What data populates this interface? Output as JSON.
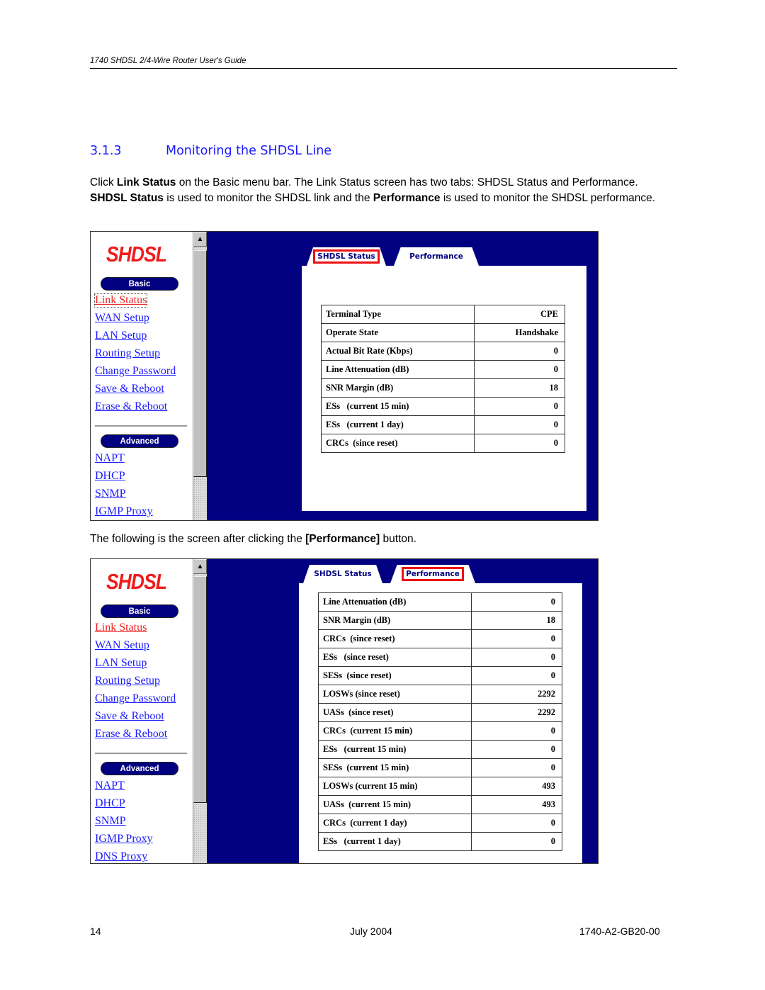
{
  "document": {
    "running_header": "1740 SHDSL 2/4-Wire Router User's Guide",
    "section": {
      "number": "3.1.3",
      "title": "Monitoring the SHDSL Line"
    },
    "intro_paragraph": {
      "p1_a": "Click ",
      "p1_b": "Link Status",
      "p1_c": " on the Basic menu bar. The Link Status screen has two tabs: SHDSL Status and Performance. ",
      "p1_d": "SHDSL Status",
      "p1_e": " is used to monitor the SHDSL link and the ",
      "p1_f": "Performance",
      "p1_g": " is used to monitor the SHDSL performance."
    },
    "caption_2": {
      "a": "The following is the screen after clicking the ",
      "b": "[Performance]",
      "c": " button."
    },
    "footer": {
      "page_number": "14",
      "date": "July 2004",
      "doc_id": "1740-A2-GB20-00"
    }
  },
  "colors": {
    "accent_blue": "#1a1aff",
    "navy": "#000080",
    "logo_red": "#ee1c1c",
    "highlight_red": "#ee1111"
  },
  "screen1": {
    "logo": "SHDSL",
    "basic_label": "Basic",
    "advanced_label": "Advanced",
    "basic_links": [
      "Link Status",
      "WAN Setup",
      "LAN Setup",
      "Routing Setup",
      "Change Password",
      "Save & Reboot",
      "Erase & Reboot"
    ],
    "advanced_links": [
      "NAPT",
      "DHCP",
      "SNMP",
      "IGMP Proxy"
    ],
    "active_link": "Link Status",
    "tabs": [
      {
        "label": "SHDSL Status",
        "selected": true
      },
      {
        "label": "Performance",
        "selected": false
      }
    ],
    "scroll_up_icon": "▲",
    "rows": [
      {
        "label": "Terminal Type",
        "value": "CPE"
      },
      {
        "label": "Operate State",
        "value": "Handshake"
      },
      {
        "label": "Actual Bit Rate (Kbps)",
        "value": "0"
      },
      {
        "label": "Line Attenuation (dB)",
        "value": "0"
      },
      {
        "label": "SNR Margin (dB)",
        "value": "18"
      },
      {
        "label": "ESs   (current 15 min)",
        "value": "0"
      },
      {
        "label": "ESs   (current 1 day)",
        "value": "0"
      },
      {
        "label": "CRCs  (since reset)",
        "value": "0"
      }
    ]
  },
  "screen2": {
    "logo": "SHDSL",
    "basic_label": "Basic",
    "advanced_label": "Advanced",
    "basic_links": [
      "Link Status",
      "WAN Setup",
      "LAN Setup",
      "Routing Setup",
      "Change Password",
      "Save & Reboot",
      "Erase & Reboot"
    ],
    "advanced_links": [
      "NAPT",
      "DHCP",
      "SNMP",
      "IGMP Proxy",
      "DNS Proxy"
    ],
    "active_link": "Link Status",
    "tabs": [
      {
        "label": "SHDSL Status",
        "selected": false
      },
      {
        "label": "Performance",
        "selected": true
      }
    ],
    "scroll_up_icon": "▲",
    "rows": [
      {
        "label": "Line Attenuation (dB)",
        "value": "0"
      },
      {
        "label": "SNR Margin (dB)",
        "value": "18"
      },
      {
        "label": "CRCs  (since reset)",
        "value": "0"
      },
      {
        "label": "ESs   (since reset)",
        "value": "0"
      },
      {
        "label": "SESs  (since reset)",
        "value": "0"
      },
      {
        "label": "LOSWs (since reset)",
        "value": "2292"
      },
      {
        "label": "UASs  (since reset)",
        "value": "2292"
      },
      {
        "label": "CRCs  (current 15 min)",
        "value": "0"
      },
      {
        "label": "ESs   (current 15 min)",
        "value": "0"
      },
      {
        "label": "SESs  (current 15 min)",
        "value": "0"
      },
      {
        "label": "LOSWs (current 15 min)",
        "value": "493"
      },
      {
        "label": "UASs  (current 15 min)",
        "value": "493"
      },
      {
        "label": "CRCs  (current 1 day)",
        "value": "0"
      },
      {
        "label": "ESs   (current 1 day)",
        "value": "0"
      }
    ]
  }
}
